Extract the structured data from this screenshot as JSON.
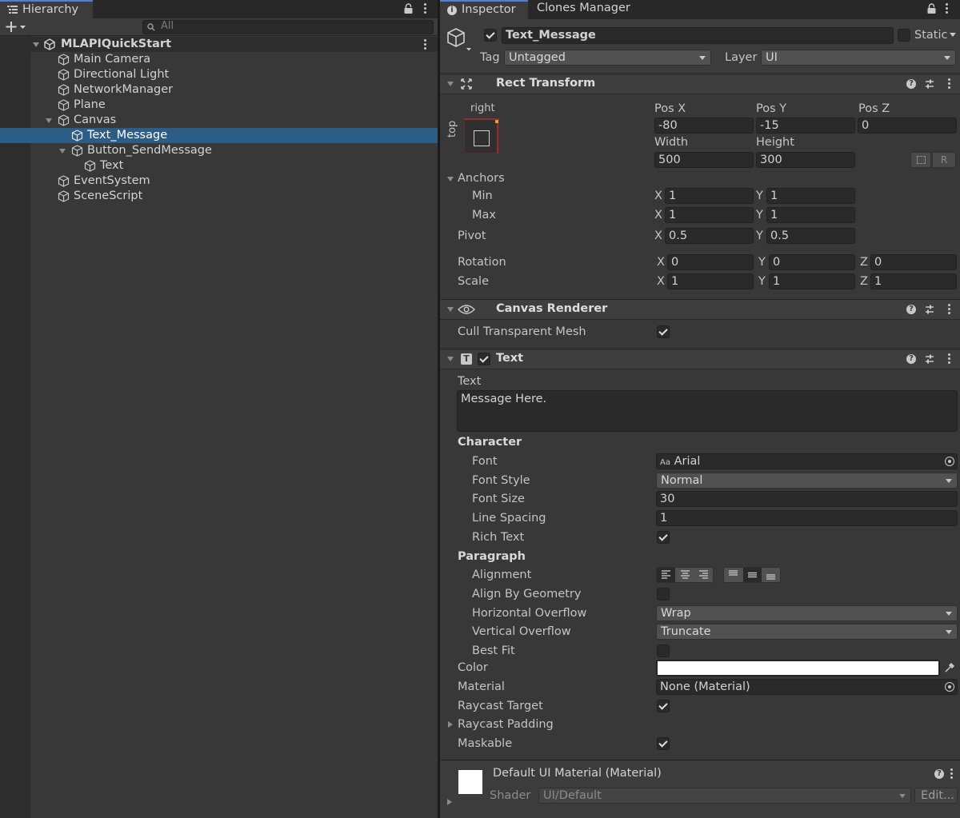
{
  "hierarchy": {
    "tab_label": "Hierarchy",
    "search_placeholder": "All",
    "scene_name": "MLAPIQuickStart",
    "items": [
      {
        "label": "Main Camera"
      },
      {
        "label": "Directional Light"
      },
      {
        "label": "NetworkManager"
      },
      {
        "label": "Plane"
      },
      {
        "label": "Canvas"
      },
      {
        "label": "Text_Message"
      },
      {
        "label": "Button_SendMessage"
      },
      {
        "label": "Text"
      },
      {
        "label": "EventSystem"
      },
      {
        "label": "SceneScript"
      }
    ]
  },
  "inspector": {
    "tabs": [
      {
        "label": "Inspector"
      },
      {
        "label": "Clones Manager"
      }
    ],
    "object": {
      "name": "Text_Message",
      "static_label": "Static",
      "tag_label": "Tag",
      "tag_value": "Untagged",
      "layer_label": "Layer",
      "layer_value": "UI"
    },
    "rect_transform": {
      "title": "Rect Transform",
      "anchor_preset_h": "right",
      "anchor_preset_v": "top",
      "pos_x_label": "Pos X",
      "pos_x": "-80",
      "pos_y_label": "Pos Y",
      "pos_y": "-15",
      "pos_z_label": "Pos Z",
      "pos_z": "0",
      "width_label": "Width",
      "width": "500",
      "height_label": "Height",
      "height": "300",
      "blueprint_btn": "R",
      "anchors_label": "Anchors",
      "min_label": "Min",
      "min_x": "1",
      "min_y": "1",
      "max_label": "Max",
      "max_x": "1",
      "max_y": "1",
      "pivot_label": "Pivot",
      "pivot_x": "0.5",
      "pivot_y": "0.5",
      "rotation_label": "Rotation",
      "rot_x": "0",
      "rot_y": "0",
      "rot_z": "0",
      "scale_label": "Scale",
      "scale_x": "1",
      "scale_y": "1",
      "scale_z": "1",
      "axis_x": "X",
      "axis_y": "Y",
      "axis_z": "Z"
    },
    "canvas_renderer": {
      "title": "Canvas Renderer",
      "cull_label": "Cull Transparent Mesh",
      "cull": true
    },
    "text": {
      "title": "Text",
      "text_label": "Text",
      "text_value": "Message Here.",
      "character_label": "Character",
      "font_label": "Font",
      "font_icon": "Aa",
      "font_value": "Arial",
      "font_style_label": "Font Style",
      "font_style_value": "Normal",
      "font_size_label": "Font Size",
      "font_size_value": "30",
      "line_spacing_label": "Line Spacing",
      "line_spacing_value": "1",
      "rich_text_label": "Rich Text",
      "rich_text": true,
      "paragraph_label": "Paragraph",
      "alignment_label": "Alignment",
      "align_by_geometry_label": "Align By Geometry",
      "align_by_geometry": false,
      "horizontal_overflow_label": "Horizontal Overflow",
      "horizontal_overflow_value": "Wrap",
      "vertical_overflow_label": "Vertical Overflow",
      "vertical_overflow_value": "Truncate",
      "best_fit_label": "Best Fit",
      "best_fit": false,
      "color_label": "Color",
      "color_value": "#ffffff",
      "material_label": "Material",
      "material_value": "None (Material)",
      "raycast_target_label": "Raycast Target",
      "raycast_target": true,
      "raycast_padding_label": "Raycast Padding",
      "maskable_label": "Maskable",
      "maskable": true
    },
    "material": {
      "title": "Default UI Material (Material)",
      "shader_label": "Shader",
      "shader_value": "UI/Default",
      "edit_label": "Edit..."
    }
  }
}
